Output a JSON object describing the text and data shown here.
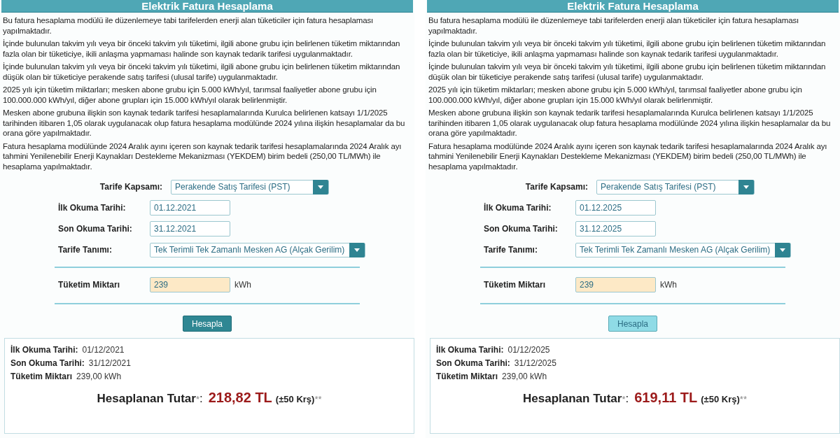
{
  "panels": [
    {
      "title": "Elektrik Fatura Hesaplama",
      "paragraphs": [
        "Bu fatura hesaplama modülü ile düzenlemeye tabi tarifelerden enerji alan tüketiciler için fatura hesaplaması yapılmaktadır.",
        "İçinde bulunulan takvim yılı veya bir önceki takvim yılı tüketimi, ilgili abone grubu için belirlenen tüketim miktarından fazla olan bir tüketiciye, ikili anlaşma yapmaması halinde son kaynak tedarik tarifesi uygulanmaktadır.",
        "İçinde bulunulan takvim yılı veya bir önceki takvim yılı tüketimi, ilgili abone grubu için belirlenen tüketim miktarından düşük olan bir tüketiciye perakende satış tarifesi (ulusal tarife) uygulanmaktadır.",
        "2025 yılı için tüketim miktarları; mesken abone grubu için 5.000 kWh/yıl, tarımsal faaliyetler abone grubu için 100.000.000 kWh/yıl, diğer abone grupları için 15.000 kWh/yıl olarak belirlenmiştir.",
        "Mesken abone grubuna ilişkin son kaynak tedarik tarifesi hesaplamalarında Kurulca belirlenen katsayı 1/1/2025 tarihinden itibaren 1,05 olarak uygulanacak olup fatura hesaplama modülünde 2024 yılına ilişkin hesaplamalar da bu orana göre yapılmaktadır.",
        "Fatura hesaplama modülünde 2024 Aralık ayını içeren son kaynak tedarik tarifesi hesaplamalarında 2024 Aralık ayı tahmini Yenilenebilir Enerji Kaynakları Destekleme Mekanizması (YEKDEM) birim bedeli (250,00 TL/MWh) ile hesaplama yapılmaktadır."
      ],
      "tariff_scope": {
        "label": "Tarife Kapsamı:",
        "value": "Perakende Satış Tarifesi (PST)"
      },
      "first_reading": {
        "label": "İlk Okuma Tarihi:",
        "value": "01.12.2021"
      },
      "last_reading": {
        "label": "Son Okuma Tarihi:",
        "value": "31.12.2021"
      },
      "tariff_definition": {
        "label": "Tarife Tanımı:",
        "value": "Tek Terimli Tek Zamanlı Mesken AG (Alçak Gerilim)"
      },
      "consumption": {
        "label": "Tüketim Miktarı",
        "value": "239",
        "unit": "kWh"
      },
      "calculate_button": {
        "label": "Hesapla",
        "hovered": false
      },
      "result": {
        "rows": [
          {
            "label": "İlk Okuma Tarihi:",
            "value": "01/12/2021"
          },
          {
            "label": "Son Okuma Tarihi:",
            "value": "31/12/2021"
          },
          {
            "label": "Tüketim Miktarı",
            "value": "239,00 kWh"
          }
        ],
        "total_label": "Hesaplanan Tutar",
        "total_mark": "*",
        "total_colon": ":",
        "amount": "218,82 TL",
        "tolerance": "(±50 Krş)",
        "tolerance_mark": "**"
      }
    },
    {
      "title": "Elektrik Fatura Hesaplama",
      "paragraphs": [
        "Bu fatura hesaplama modülü ile düzenlemeye tabi tarifelerden enerji alan tüketiciler için fatura hesaplaması yapılmaktadır.",
        "İçinde bulunulan takvim yılı veya bir önceki takvim yılı tüketimi, ilgili abone grubu için belirlenen tüketim miktarından fazla olan bir tüketiciye, ikili anlaşma yapmaması halinde son kaynak tedarik tarifesi uygulanmaktadır.",
        "İçinde bulunulan takvim yılı veya bir önceki takvim yılı tüketimi, ilgili abone grubu için belirlenen tüketim miktarından düşük olan bir tüketiciye perakende satış tarifesi (ulusal tarife) uygulanmaktadır.",
        "2025 yılı için tüketim miktarları; mesken abone grubu için 5.000 kWh/yıl, tarımsal faaliyetler abone grubu için 100.000.000 kWh/yıl, diğer abone grupları için 15.000 kWh/yıl olarak belirlenmiştir.",
        "Mesken abone grubuna ilişkin son kaynak tedarik tarifesi hesaplamalarında Kurulca belirlenen katsayı 1/1/2025 tarihinden itibaren 1,05 olarak uygulanacak olup fatura hesaplama modülünde 2024 yılına ilişkin hesaplamalar da bu orana göre yapılmaktadır.",
        "Fatura hesaplama modülünde 2024 Aralık ayını içeren son kaynak tedarik tarifesi hesaplamalarında 2024 Aralık ayı tahmini Yenilenebilir Enerji Kaynakları Destekleme Mekanizması (YEKDEM) birim bedeli (250,00 TL/MWh) ile hesaplama yapılmaktadır."
      ],
      "tariff_scope": {
        "label": "Tarife Kapsamı:",
        "value": "Perakende Satış Tarifesi (PST)"
      },
      "first_reading": {
        "label": "İlk Okuma Tarihi:",
        "value": "01.12.2025"
      },
      "last_reading": {
        "label": "Son Okuma Tarihi:",
        "value": "31.12.2025"
      },
      "tariff_definition": {
        "label": "Tarife Tanımı:",
        "value": "Tek Terimli Tek Zamanlı Mesken AG (Alçak Gerilim)"
      },
      "consumption": {
        "label": "Tüketim Miktarı",
        "value": "239",
        "unit": "kWh"
      },
      "calculate_button": {
        "label": "Hesapla",
        "hovered": true
      },
      "result": {
        "rows": [
          {
            "label": "İlk Okuma Tarihi:",
            "value": "01/12/2025"
          },
          {
            "label": "Son Okuma Tarihi:",
            "value": "31/12/2025"
          },
          {
            "label": "Tüketim Miktarı",
            "value": "239,00 kWh"
          }
        ],
        "total_label": "Hesaplanan Tutar",
        "total_mark": "*",
        "total_colon": ":",
        "amount": "619,11 TL",
        "tolerance": "(±50 Krş)",
        "tolerance_mark": "**"
      }
    }
  ]
}
